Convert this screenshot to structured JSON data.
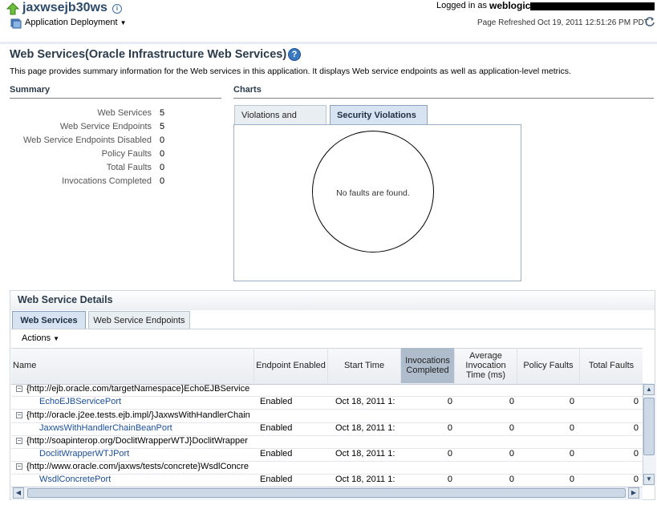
{
  "header": {
    "app_name": "jaxwsejb30ws",
    "menu_label": "Application Deployment",
    "logged_in_label": "Logged in as",
    "user": "weblogic",
    "refreshed": "Page Refreshed Oct 19, 2011 12:51:26 PM PDT"
  },
  "page": {
    "title": "Web Services(Oracle Infrastructure Web Services)",
    "description": "This page provides summary information for the Web services in this application. It displays Web service endpoints as well as application-level metrics."
  },
  "summary": {
    "heading": "Summary",
    "items": [
      {
        "label": "Web Services",
        "value": "5"
      },
      {
        "label": "Web Service Endpoints",
        "value": "5"
      },
      {
        "label": "Web Service Endpoints Disabled",
        "value": "0"
      },
      {
        "label": "Policy Faults",
        "value": "0"
      },
      {
        "label": "Total Faults",
        "value": "0"
      },
      {
        "label": "Invocations Completed",
        "value": "0"
      }
    ]
  },
  "charts": {
    "heading": "Charts",
    "tabs": [
      "Violations and Faults",
      "Security Violations"
    ],
    "active_tab": "Security Violations",
    "empty_message": "No faults are found."
  },
  "details": {
    "heading": "Web Service Details",
    "tabs": [
      "Web Services",
      "Web Service Endpoints"
    ],
    "actions_label": "Actions",
    "columns": [
      "Name",
      "Endpoint Enabled",
      "Start Time",
      "Invocations Completed",
      "Average Invocation Time (ms)",
      "Policy Faults",
      "Total Faults"
    ],
    "groups": [
      {
        "service": "{http://ejb.oracle.com/targetNamespace}EchoEJBService",
        "port": "EchoEJBServicePort",
        "enabled": "Enabled",
        "start": "Oct 18, 2011 1:",
        "invocations": "0",
        "avg_time": "0",
        "policy_faults": "0",
        "total_faults": "0"
      },
      {
        "service": "{http://oracle.j2ee.tests.ejb.impl/}JaxwsWithHandlerChain",
        "port": "JaxwsWithHandlerChainBeanPort",
        "enabled": "Enabled",
        "start": "Oct 18, 2011 1:",
        "invocations": "0",
        "avg_time": "0",
        "policy_faults": "0",
        "total_faults": "0"
      },
      {
        "service": "{http://soapinterop.org/DoclitWrapperWTJ}DoclitWrapper",
        "port": "DoclitWrapperWTJPort",
        "enabled": "Enabled",
        "start": "Oct 18, 2011 1:",
        "invocations": "0",
        "avg_time": "0",
        "policy_faults": "0",
        "total_faults": "0"
      },
      {
        "service": "{http://www.oracle.com/jaxws/tests/concrete}WsdlConcre",
        "port": "WsdlConcretePort",
        "enabled": "Enabled",
        "start": "Oct 18, 2011 1:",
        "invocations": "0",
        "avg_time": "0",
        "policy_faults": "0",
        "total_faults": "0"
      }
    ]
  },
  "icons": {
    "home": "home-up-arrow-icon",
    "info": "info-icon",
    "help": "help-icon",
    "refresh": "refresh-icon",
    "deployment": "deployment-icon"
  },
  "colors": {
    "title": "#2b3b4c",
    "link": "#1a4e9a",
    "active_tab": "#d7e3f1",
    "sorted_column": "#aebccc"
  }
}
